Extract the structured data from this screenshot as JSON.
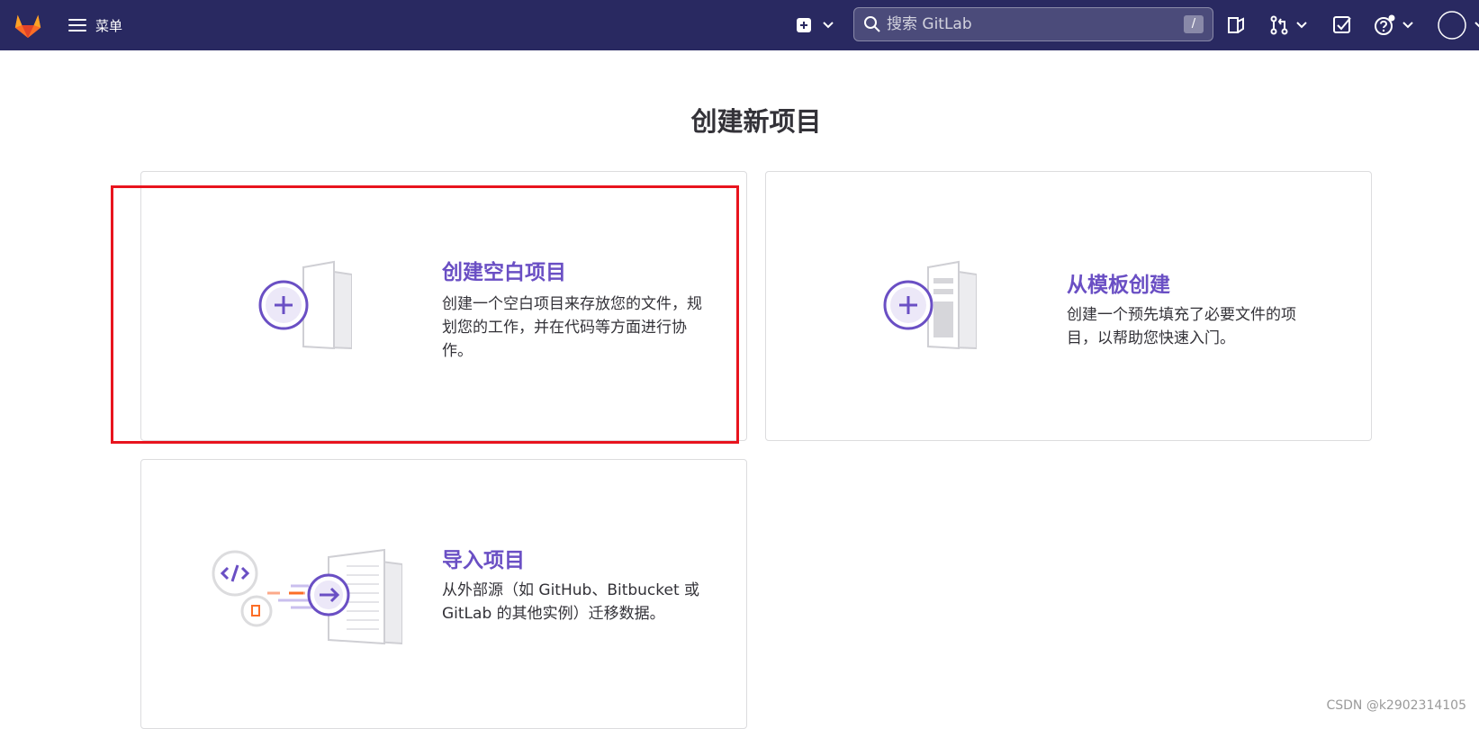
{
  "topbar": {
    "menu_label": "菜单",
    "search_placeholder": "搜索 GitLab",
    "search_shortcut": "/"
  },
  "page": {
    "title": "创建新项目"
  },
  "cards": [
    {
      "title": "创建空白项目",
      "desc": "创建一个空白项目来存放您的文件，规划您的工作，并在代码等方面进行协作。"
    },
    {
      "title": "从模板创建",
      "desc": "创建一个预先填充了必要文件的项目，以帮助您快速入门。"
    },
    {
      "title": "导入项目",
      "desc": "从外部源（如 GitHub、Bitbucket 或 GitLab 的其他实例）迁移数据。"
    }
  ],
  "watermark": "CSDN @k2902314105",
  "colors": {
    "topbar": "#292961",
    "accent": "#6a4fc4",
    "highlight": "#e8141e"
  }
}
